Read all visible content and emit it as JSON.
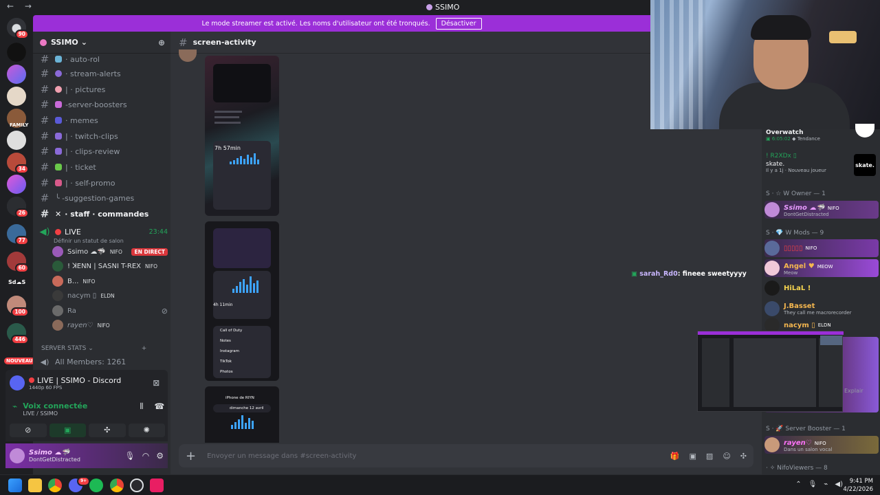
{
  "titlebar": {
    "back": "←",
    "forward": "→",
    "title": "SSIMO"
  },
  "banner": {
    "text": "Le mode streamer est activé. Les noms d'utilisateur ont été tronqués.",
    "button": "Désactiver"
  },
  "rail": {
    "badges": [
      "90",
      "34",
      "26",
      "77",
      "60",
      "100",
      "446"
    ],
    "labels": {
      "family": "FAMILY",
      "sds": "Sd☁S",
      "new": "NOUVEAU"
    }
  },
  "server": {
    "name": "SSIMO",
    "chevron": "⌄"
  },
  "channels": [
    {
      "label": "· auto-rol"
    },
    {
      "label": "· stream-alerts"
    },
    {
      "label": "| · pictures"
    },
    {
      "label": "-server-boosters"
    },
    {
      "label": "· memes"
    },
    {
      "label": "| · twitch-clips"
    },
    {
      "label": "| · clips-review"
    },
    {
      "label": "| · ticket"
    },
    {
      "label": "| · self-promo"
    },
    {
      "label": "╰ -suggestion-games"
    },
    {
      "label": "· staff · commandes"
    }
  ],
  "voice": {
    "name": "LIVE",
    "time": "23:44",
    "status": "Définir un statut de salon",
    "users": [
      {
        "name": "Ssimo ☁🦈",
        "tag": "NIFO",
        "live": "EN DIRECT"
      },
      {
        "name": "! ꓘENN | SASNI T-REX",
        "tag": "NIFO",
        "live": ""
      },
      {
        "name": "B...",
        "tag": "NIFO",
        "live": ""
      },
      {
        "name": "nacym ▯",
        "tag": "ELDN",
        "live": ""
      },
      {
        "name": "Ra",
        "tag": "",
        "live": ""
      },
      {
        "name": "rayen♡",
        "tag": "NIFO",
        "live": ""
      }
    ]
  },
  "stats": {
    "category": "SERVER STATS",
    "members": "All Members: 1261"
  },
  "stream_panel": {
    "title": "LIVE | SSIMO - Discord",
    "quality": "1440p 60 FPS",
    "connected": "Voix connectée",
    "channel": "LIVE / SSIMO"
  },
  "user": {
    "name": "Ssimo ☁🦈",
    "status": "DontGetDistracted"
  },
  "main": {
    "channel": "screen-activity",
    "screenshot_texts": {
      "s1_time": "7h 57min",
      "s2_time": "4h 11min",
      "s3_title": "iPhone de RIYN",
      "s3_date": "dimanche 12 avril",
      "s2_apps": [
        "Call of Duty",
        "Notes",
        "Instagram",
        "TikTok",
        "Photos"
      ]
    },
    "overlay_user": "sarah_Rd0",
    "overlay_text": ": fineee sweetyyyy",
    "composer_placeholder": "Envoyer un message dans #screen-activity"
  },
  "members": {
    "top_game": "Overwatch",
    "top_time": "6:05:02",
    "top_trend": "Tendance",
    "r2": "! R2XDx ▯",
    "r2_game": "skate.",
    "r2_sub": "Il y a 1j",
    "r2_new": "Nouveau joueur",
    "skate_logo": "skate.",
    "owner_header": "S · ☆ W Owner — 1",
    "owner": {
      "name": "Ssimo ☁🦈",
      "tag": "NIFO",
      "status": "DontGetDistracted"
    },
    "mods_header": "S · 💎 W Mods — 9",
    "mods": [
      {
        "name": "▯▯▯▯▯",
        "tag": "NIFO",
        "status": "",
        "color": "#f23f43"
      },
      {
        "name": "Angel ♥",
        "tag": "MEOW",
        "status": "Meow",
        "color": "#f5b74f"
      },
      {
        "name": "HiLaL !",
        "tag": "",
        "status": "",
        "color": "#f5d44f"
      },
      {
        "name": "J.Basset",
        "tag": "",
        "status": "They call me macrorecorder",
        "color": "#f5b74f"
      },
      {
        "name": "nacym ▯",
        "tag": "ELDN",
        "status": "",
        "color": "#f5b74f"
      }
    ],
    "booster_header": "S · 🚀 Server Booster — 1",
    "booster": {
      "name": "rayen♡",
      "tag": "NIFO",
      "status": "Dans un salon vocal"
    },
    "viewers_header": "· ✧ NifoViewers — 8",
    "explain": "Explair"
  },
  "taskbar": {
    "time": "9:41 PM",
    "date": "4/22/2026",
    "discord_badge": "9+"
  }
}
